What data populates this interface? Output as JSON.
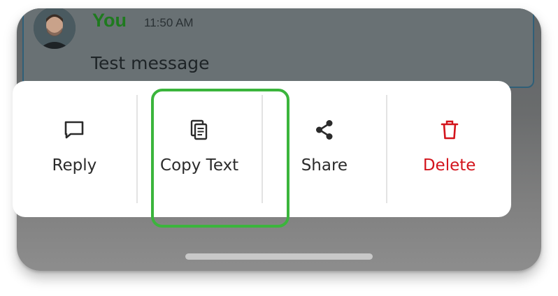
{
  "message": {
    "sender": "You",
    "time": "11:50 AM",
    "text": "Test message"
  },
  "menu": {
    "items": [
      {
        "label": "Reply",
        "icon": "chat-bubble-icon"
      },
      {
        "label": "Copy Text",
        "icon": "copy-icon"
      },
      {
        "label": "Share",
        "icon": "share-icon"
      },
      {
        "label": "Delete",
        "icon": "trash-icon"
      }
    ]
  },
  "colors": {
    "sender": "#1f7a1f",
    "highlight": "#3bb53c",
    "delete": "#d3141c",
    "card_border": "#2f5f78"
  }
}
